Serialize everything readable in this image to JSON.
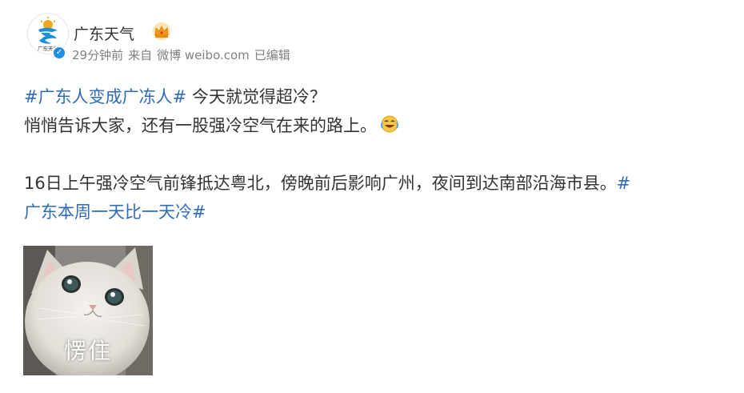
{
  "post": {
    "author": {
      "name": "广东天气",
      "avatar_text": "广东天气",
      "verified": true
    },
    "meta": {
      "time": "29分钟前",
      "source_prefix": "来自",
      "source": "微博 weibo.com",
      "edited": "已编辑"
    },
    "content": {
      "hashtag1": "#广东人变成广冻人#",
      "line1_text": "今天就觉得超冷？",
      "line2_text": "悄悄告诉大家，还有一股强冷空气在来的路上。",
      "line3_text": "16日上午强冷空气前锋抵达粤北，傍晚前后影响广州，夜间到达南部沿海市县。",
      "hashtag2_part1": "#",
      "hashtag2_part2": "广东本周一天比一天冷#"
    },
    "image": {
      "caption": "愣住"
    }
  },
  "colors": {
    "hashtag": "#2f6cb8",
    "meta_text": "#808080",
    "body_text": "#333333",
    "verified_badge": "#1e8ee6"
  },
  "icons": [
    "avatar-logo",
    "verified-icon",
    "crown-icon",
    "laughing-emoji-icon"
  ]
}
